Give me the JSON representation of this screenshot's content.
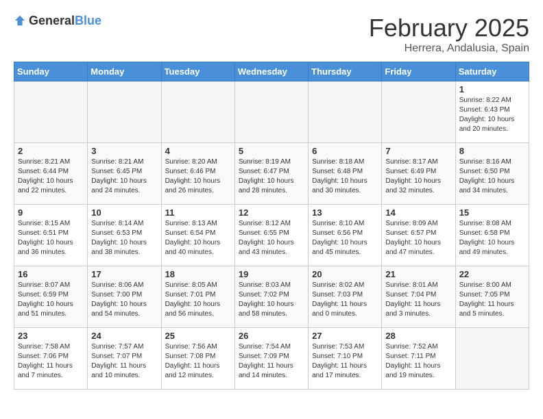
{
  "logo": {
    "general": "General",
    "blue": "Blue"
  },
  "title": "February 2025",
  "location": "Herrera, Andalusia, Spain",
  "weekdays": [
    "Sunday",
    "Monday",
    "Tuesday",
    "Wednesday",
    "Thursday",
    "Friday",
    "Saturday"
  ],
  "weeks": [
    [
      {
        "day": "",
        "info": ""
      },
      {
        "day": "",
        "info": ""
      },
      {
        "day": "",
        "info": ""
      },
      {
        "day": "",
        "info": ""
      },
      {
        "day": "",
        "info": ""
      },
      {
        "day": "",
        "info": ""
      },
      {
        "day": "1",
        "info": "Sunrise: 8:22 AM\nSunset: 6:43 PM\nDaylight: 10 hours and 20 minutes."
      }
    ],
    [
      {
        "day": "2",
        "info": "Sunrise: 8:21 AM\nSunset: 6:44 PM\nDaylight: 10 hours and 22 minutes."
      },
      {
        "day": "3",
        "info": "Sunrise: 8:21 AM\nSunset: 6:45 PM\nDaylight: 10 hours and 24 minutes."
      },
      {
        "day": "4",
        "info": "Sunrise: 8:20 AM\nSunset: 6:46 PM\nDaylight: 10 hours and 26 minutes."
      },
      {
        "day": "5",
        "info": "Sunrise: 8:19 AM\nSunset: 6:47 PM\nDaylight: 10 hours and 28 minutes."
      },
      {
        "day": "6",
        "info": "Sunrise: 8:18 AM\nSunset: 6:48 PM\nDaylight: 10 hours and 30 minutes."
      },
      {
        "day": "7",
        "info": "Sunrise: 8:17 AM\nSunset: 6:49 PM\nDaylight: 10 hours and 32 minutes."
      },
      {
        "day": "8",
        "info": "Sunrise: 8:16 AM\nSunset: 6:50 PM\nDaylight: 10 hours and 34 minutes."
      }
    ],
    [
      {
        "day": "9",
        "info": "Sunrise: 8:15 AM\nSunset: 6:51 PM\nDaylight: 10 hours and 36 minutes."
      },
      {
        "day": "10",
        "info": "Sunrise: 8:14 AM\nSunset: 6:53 PM\nDaylight: 10 hours and 38 minutes."
      },
      {
        "day": "11",
        "info": "Sunrise: 8:13 AM\nSunset: 6:54 PM\nDaylight: 10 hours and 40 minutes."
      },
      {
        "day": "12",
        "info": "Sunrise: 8:12 AM\nSunset: 6:55 PM\nDaylight: 10 hours and 43 minutes."
      },
      {
        "day": "13",
        "info": "Sunrise: 8:10 AM\nSunset: 6:56 PM\nDaylight: 10 hours and 45 minutes."
      },
      {
        "day": "14",
        "info": "Sunrise: 8:09 AM\nSunset: 6:57 PM\nDaylight: 10 hours and 47 minutes."
      },
      {
        "day": "15",
        "info": "Sunrise: 8:08 AM\nSunset: 6:58 PM\nDaylight: 10 hours and 49 minutes."
      }
    ],
    [
      {
        "day": "16",
        "info": "Sunrise: 8:07 AM\nSunset: 6:59 PM\nDaylight: 10 hours and 51 minutes."
      },
      {
        "day": "17",
        "info": "Sunrise: 8:06 AM\nSunset: 7:00 PM\nDaylight: 10 hours and 54 minutes."
      },
      {
        "day": "18",
        "info": "Sunrise: 8:05 AM\nSunset: 7:01 PM\nDaylight: 10 hours and 56 minutes."
      },
      {
        "day": "19",
        "info": "Sunrise: 8:03 AM\nSunset: 7:02 PM\nDaylight: 10 hours and 58 minutes."
      },
      {
        "day": "20",
        "info": "Sunrise: 8:02 AM\nSunset: 7:03 PM\nDaylight: 11 hours and 0 minutes."
      },
      {
        "day": "21",
        "info": "Sunrise: 8:01 AM\nSunset: 7:04 PM\nDaylight: 11 hours and 3 minutes."
      },
      {
        "day": "22",
        "info": "Sunrise: 8:00 AM\nSunset: 7:05 PM\nDaylight: 11 hours and 5 minutes."
      }
    ],
    [
      {
        "day": "23",
        "info": "Sunrise: 7:58 AM\nSunset: 7:06 PM\nDaylight: 11 hours and 7 minutes."
      },
      {
        "day": "24",
        "info": "Sunrise: 7:57 AM\nSunset: 7:07 PM\nDaylight: 11 hours and 10 minutes."
      },
      {
        "day": "25",
        "info": "Sunrise: 7:56 AM\nSunset: 7:08 PM\nDaylight: 11 hours and 12 minutes."
      },
      {
        "day": "26",
        "info": "Sunrise: 7:54 AM\nSunset: 7:09 PM\nDaylight: 11 hours and 14 minutes."
      },
      {
        "day": "27",
        "info": "Sunrise: 7:53 AM\nSunset: 7:10 PM\nDaylight: 11 hours and 17 minutes."
      },
      {
        "day": "28",
        "info": "Sunrise: 7:52 AM\nSunset: 7:11 PM\nDaylight: 11 hours and 19 minutes."
      },
      {
        "day": "",
        "info": ""
      }
    ]
  ]
}
